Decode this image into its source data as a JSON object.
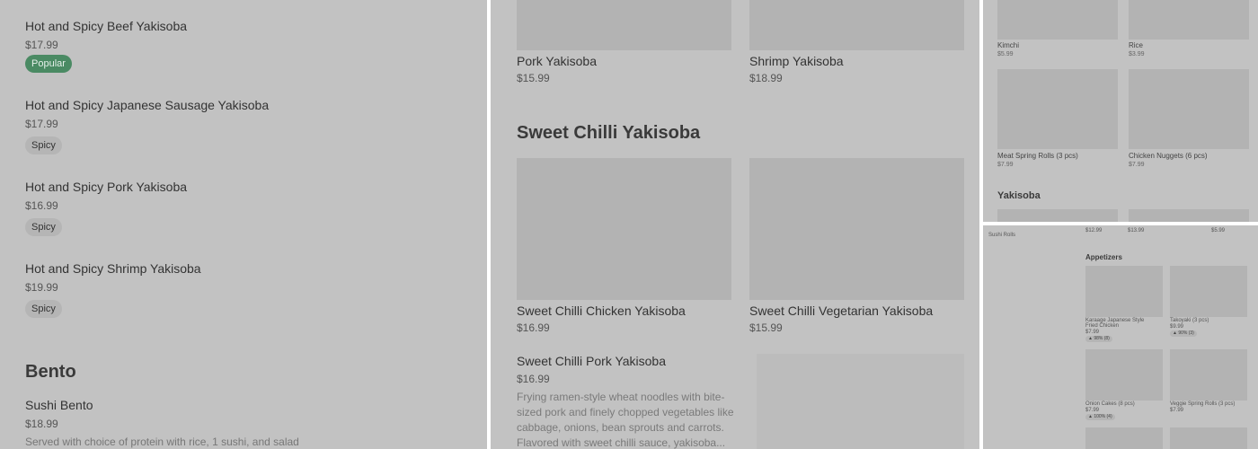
{
  "panel1": {
    "items": [
      {
        "name": "Hot and Spicy Beef Yakisoba",
        "price": "$17.99",
        "badge": "Popular"
      },
      {
        "name": "Hot and Spicy Japanese Sausage Yakisoba",
        "price": "$17.99",
        "badge": "Spicy"
      },
      {
        "name": "Hot and Spicy Pork Yakisoba",
        "price": "$16.99",
        "badge": "Spicy"
      },
      {
        "name": "Hot and Spicy Shrimp Yakisoba",
        "price": "$19.99",
        "badge": "Spicy"
      }
    ],
    "section_title": "Bento",
    "bento": {
      "name": "Sushi Bento",
      "price": "$18.99",
      "description": "Served with choice of protein with rice, 1 sushi, and salad"
    }
  },
  "panel2": {
    "top_items": [
      {
        "name": "Pork Yakisoba",
        "price": "$15.99"
      },
      {
        "name": "Shrimp Yakisoba",
        "price": "$18.99"
      }
    ],
    "section_title": "Sweet Chilli Yakisoba",
    "grid_items": [
      {
        "name": "Sweet Chilli Chicken Yakisoba",
        "price": "$16.99"
      },
      {
        "name": "Sweet Chilli Vegetarian Yakisoba",
        "price": "$15.99"
      }
    ],
    "list_item": {
      "name": "Sweet Chilli Pork Yakisoba",
      "price": "$16.99",
      "description": "Frying ramen-style wheat noodles with bite-sized pork and finely chopped vegetables like cabbage, onions, bean sprouts and carrots. Flavored with sweet chilli sauce, yakisoba..."
    }
  },
  "panel3": {
    "items": [
      {
        "name": "Kimchi",
        "price": "$5.99"
      },
      {
        "name": "Rice",
        "price": "$3.99"
      },
      {
        "name": "Meat Spring Rolls (3 pcs)",
        "price": "$7.99"
      },
      {
        "name": "Chicken Nuggets (6 pcs)",
        "price": "$7.99"
      }
    ],
    "section_title": "Yakisoba"
  },
  "panel4": {
    "top_prices": [
      "$12.99",
      "$13.99",
      "$5.99"
    ],
    "sidebar_label": "Sushi Rolls",
    "section_title": "Appetizers",
    "items": [
      {
        "name": "Karaage Japanese Style Fried Chicken",
        "price": "$7.99",
        "rating": "98% (8)"
      },
      {
        "name": "Takoyaki (3 pcs)",
        "price": "$9.99",
        "rating": "90% (3)"
      },
      {
        "name": "Onion Cakes (8 pcs)",
        "price": "$7.99",
        "rating": "100% (4)"
      },
      {
        "name": "Veggie Spring Rolls (3 pcs)",
        "price": "$7.99",
        "rating": ""
      }
    ]
  }
}
